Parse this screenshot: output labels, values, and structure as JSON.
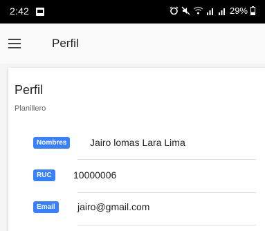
{
  "status_bar": {
    "time": "2:42",
    "battery": "29%",
    "icons": [
      "image-notification-icon",
      "alarm-icon",
      "mute-icon",
      "wifi-icon",
      "signal-icon",
      "signal-icon-2",
      "battery-icon"
    ]
  },
  "app_bar": {
    "title": "Perfil",
    "menu_icon": "menu-icon"
  },
  "profile": {
    "title": "Perfil",
    "subtitle": "Planillero",
    "fields": [
      {
        "label": "Nombres",
        "value": "Jairo lomas Lara Lima"
      },
      {
        "label": "RUC",
        "value": "10000006"
      },
      {
        "label": "Email",
        "value": "jairo@gmail.com"
      }
    ]
  },
  "colors": {
    "badge": "#3880ff",
    "status_bar": "#000000",
    "app_bar": "#fafafa"
  }
}
